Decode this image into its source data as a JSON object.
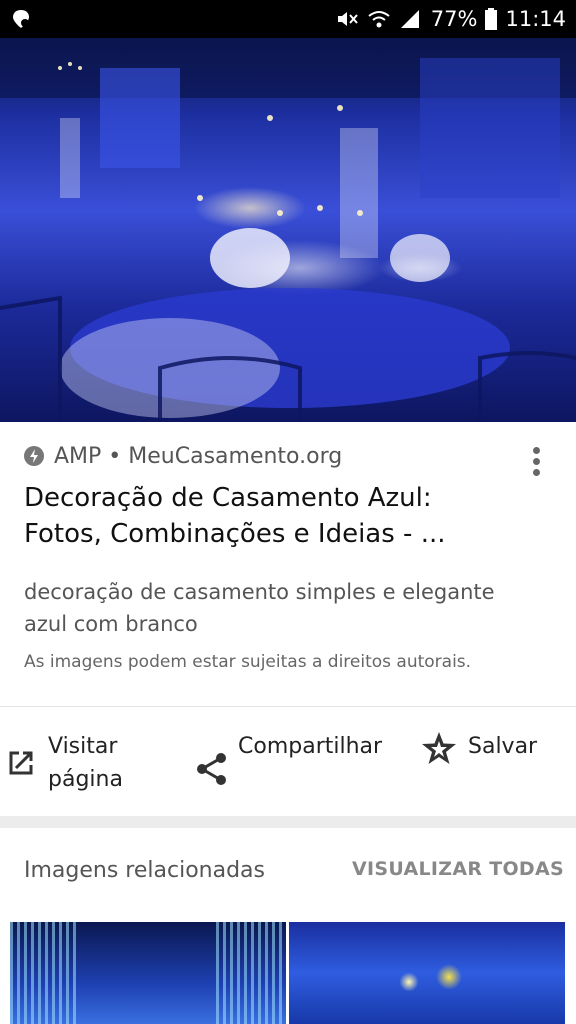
{
  "status_bar": {
    "battery": "77%",
    "time": "11:14"
  },
  "result": {
    "source": "AMP • MeuCasamento.org",
    "title_line1": "Decoração de Casamento Azul:",
    "title_line2": "Fotos, Combinações e Ideias - ...",
    "description_line1": "decoração de casamento simples e elegante",
    "description_line2": "azul com branco",
    "copyright_notice": "As imagens podem estar sujeitas a direitos autorais."
  },
  "actions": {
    "visit_line1": "Visitar",
    "visit_line2": "página",
    "share": "Compartilhar",
    "save": "Salvar"
  },
  "related": {
    "title": "Imagens relacionadas",
    "view_all": "VISUALIZAR TODAS"
  },
  "colors": {
    "status_bar": "#000000",
    "hero_blue": "#3a4fd8"
  }
}
